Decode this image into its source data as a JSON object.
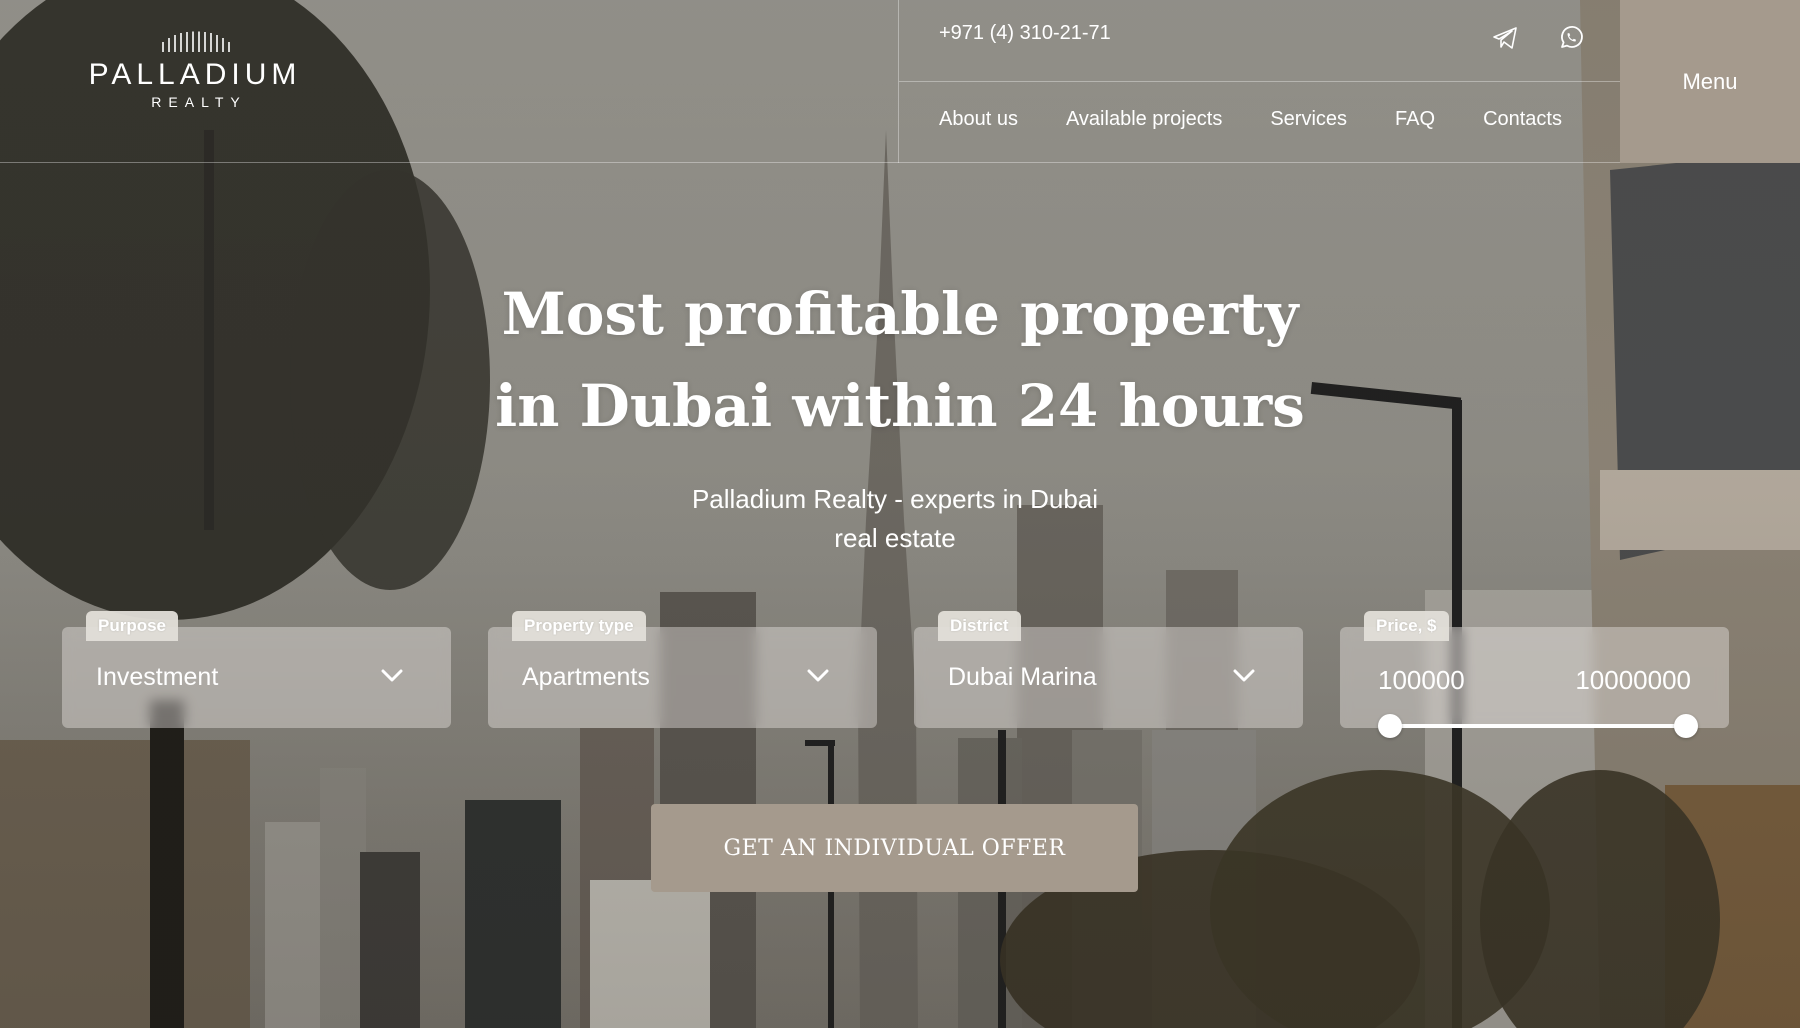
{
  "brand": {
    "name": "PALLADIUM",
    "sub": "REALTY"
  },
  "header": {
    "phone": "+971 (4) 310-21-71",
    "social": [
      {
        "icon": "telegram-icon"
      },
      {
        "icon": "whatsapp-icon"
      }
    ],
    "nav": [
      "About us",
      "Available projects",
      "Services",
      "FAQ",
      "Contacts"
    ],
    "menu_label": "Menu"
  },
  "hero": {
    "title_line1": "Most profitable property",
    "title_line2": "in Dubai within 24 hours",
    "subtitle_line1": "Palladium Realty - experts in Dubai",
    "subtitle_line2": "real estate"
  },
  "filters": {
    "purpose": {
      "label": "Purpose",
      "value": "Investment"
    },
    "property_type": {
      "label": "Property type",
      "value": "Apartments"
    },
    "district": {
      "label": "District",
      "value": "Dubai Marina"
    },
    "price": {
      "label": "Price, $",
      "min": "100000",
      "max": "10000000",
      "range_fraction": [
        0.0,
        1.0
      ]
    }
  },
  "cta": {
    "label": "GET AN INDIVIDUAL OFFER"
  },
  "colors": {
    "accent": "#a59a8d",
    "text": "#ffffff"
  }
}
